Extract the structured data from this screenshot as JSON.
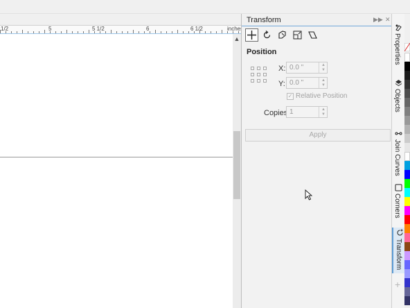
{
  "ruler": {
    "labels": [
      "1/2",
      "5",
      "5 1/2",
      "6",
      "6 1/2",
      "inches"
    ]
  },
  "docker": {
    "title": "Transform",
    "tools": [
      {
        "name": "position-icon",
        "active": true
      },
      {
        "name": "rotate-icon",
        "active": false
      },
      {
        "name": "scale-mirror-icon",
        "active": false
      },
      {
        "name": "size-icon",
        "active": false
      },
      {
        "name": "skew-icon",
        "active": false
      }
    ],
    "section_title": "Position",
    "x_label": "X:",
    "x_value": "0.0 \"",
    "y_label": "Y:",
    "y_value": "0.0 \"",
    "relative_position_label": "Relative Position",
    "relative_position_checked": true,
    "copies_label": "Copies:",
    "copies_value": "1",
    "apply_label": "Apply"
  },
  "tabs": [
    {
      "label": "Properties",
      "icon": "properties-icon",
      "active": false
    },
    {
      "label": "Objects",
      "icon": "layers-icon",
      "active": false
    },
    {
      "label": "Join Curves",
      "icon": "join-curves-icon",
      "active": false
    },
    {
      "label": "Corners",
      "icon": "corners-icon",
      "active": false
    },
    {
      "label": "Transform",
      "icon": "transform-icon",
      "active": true
    }
  ],
  "palette": {
    "colors": [
      "#ffffff",
      "#000000",
      "#1a1a1a",
      "#333333",
      "#4d4d4d",
      "#666666",
      "#808080",
      "#999999",
      "#b3b3b3",
      "#cccccc",
      "#e6e6e6",
      "#ffffff",
      "#00a0e0",
      "#0000ff",
      "#00ff00",
      "#00ffff",
      "#ffff00",
      "#ff00ff",
      "#ff0000",
      "#ff8000",
      "#ff6699",
      "#8b4513",
      "#cc99ff",
      "#6666ff",
      "#9999ff",
      "#3333cc",
      "#666699",
      "#333366"
    ]
  }
}
